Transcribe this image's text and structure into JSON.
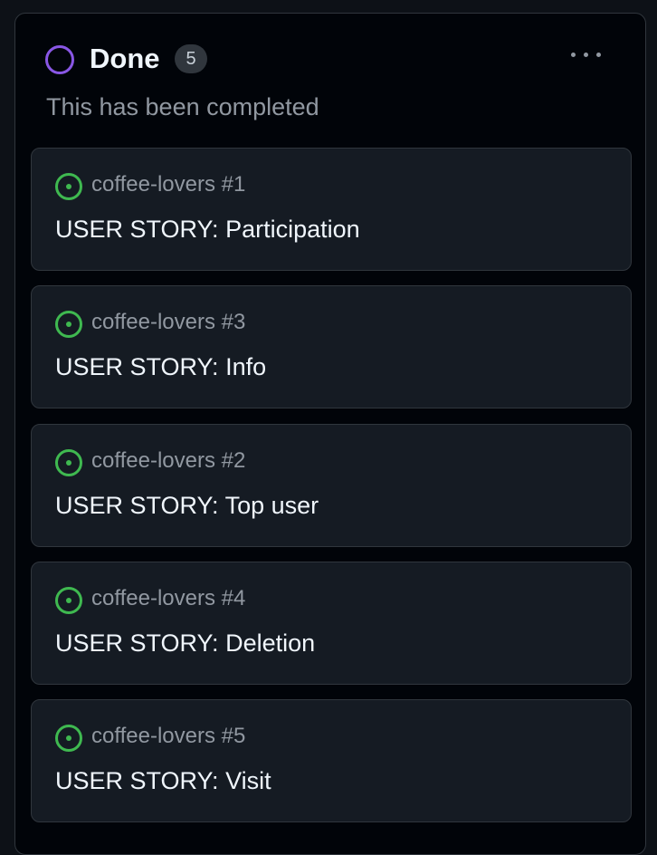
{
  "column": {
    "title": "Done",
    "count": "5",
    "description": "This has been completed",
    "status_color": "#8957e5",
    "menu_icon": "kebab-horizontal-icon"
  },
  "cards": [
    {
      "repo": "coffee-lovers #1",
      "title": "USER STORY: Participation",
      "state": "open",
      "icon": "issue-opened-icon"
    },
    {
      "repo": "coffee-lovers #3",
      "title": "USER STORY: Info",
      "state": "open",
      "icon": "issue-opened-icon"
    },
    {
      "repo": "coffee-lovers #2",
      "title": "USER STORY: Top user",
      "state": "open",
      "icon": "issue-opened-icon"
    },
    {
      "repo": "coffee-lovers #4",
      "title": "USER STORY: Deletion",
      "state": "open",
      "icon": "issue-opened-icon"
    },
    {
      "repo": "coffee-lovers #5",
      "title": "USER STORY: Visit",
      "state": "open",
      "icon": "issue-opened-icon"
    }
  ],
  "colors": {
    "background": "#0d1117",
    "column_bg": "#010409",
    "card_bg": "#151b23",
    "border": "#30363d",
    "open_issue": "#3fb950",
    "text_primary": "#f0f6fc",
    "text_muted": "#9198a1"
  }
}
